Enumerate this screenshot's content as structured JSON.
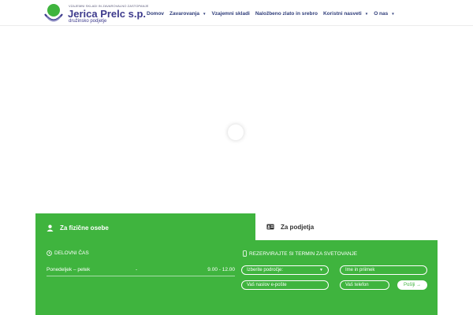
{
  "brand": {
    "tagline": "VZAJEMNI SKLADI IN ZAVAROVALNO ZASTOPANJE",
    "name": "Jerica Prelc s.p.",
    "subtitle": "družinsko podjetje",
    "colors": {
      "green": "#3fb43e",
      "navy": "#3d3a8c",
      "ring": "#7a7ab8"
    }
  },
  "nav": {
    "items": [
      {
        "label": "Domov",
        "dropdown": false
      },
      {
        "label": "Zavarovanja",
        "dropdown": true
      },
      {
        "label": "Vzajemni skladi",
        "dropdown": false
      },
      {
        "label": "Naložbeno zlato in srebro",
        "dropdown": false
      },
      {
        "label": "Koristni nasveti",
        "dropdown": true
      },
      {
        "label": "O nas",
        "dropdown": true
      }
    ]
  },
  "tabs": {
    "private": {
      "label": "Za fizične osebe",
      "icon": "user-icon",
      "active": true
    },
    "business": {
      "label": "Za podjetja",
      "icon": "id-card-icon",
      "active": false
    }
  },
  "hours": {
    "title": "DELOVNI ČAS",
    "icon": "clock-icon",
    "rows": [
      {
        "day": "Ponedeljek – petek",
        "sep": "-",
        "time": "9.00 - 12.00"
      }
    ]
  },
  "booking": {
    "title": "REZERVIRAJTE SI TERMIN ZA SVETOVANJE",
    "icon": "mobile-icon",
    "area_placeholder": "Izberite področje:",
    "name_placeholder": "Ime in priimek",
    "email_placeholder": "Vaš naslov e-pošte",
    "phone_placeholder": "Vaš telefon",
    "send_label": "Pošlji →"
  }
}
